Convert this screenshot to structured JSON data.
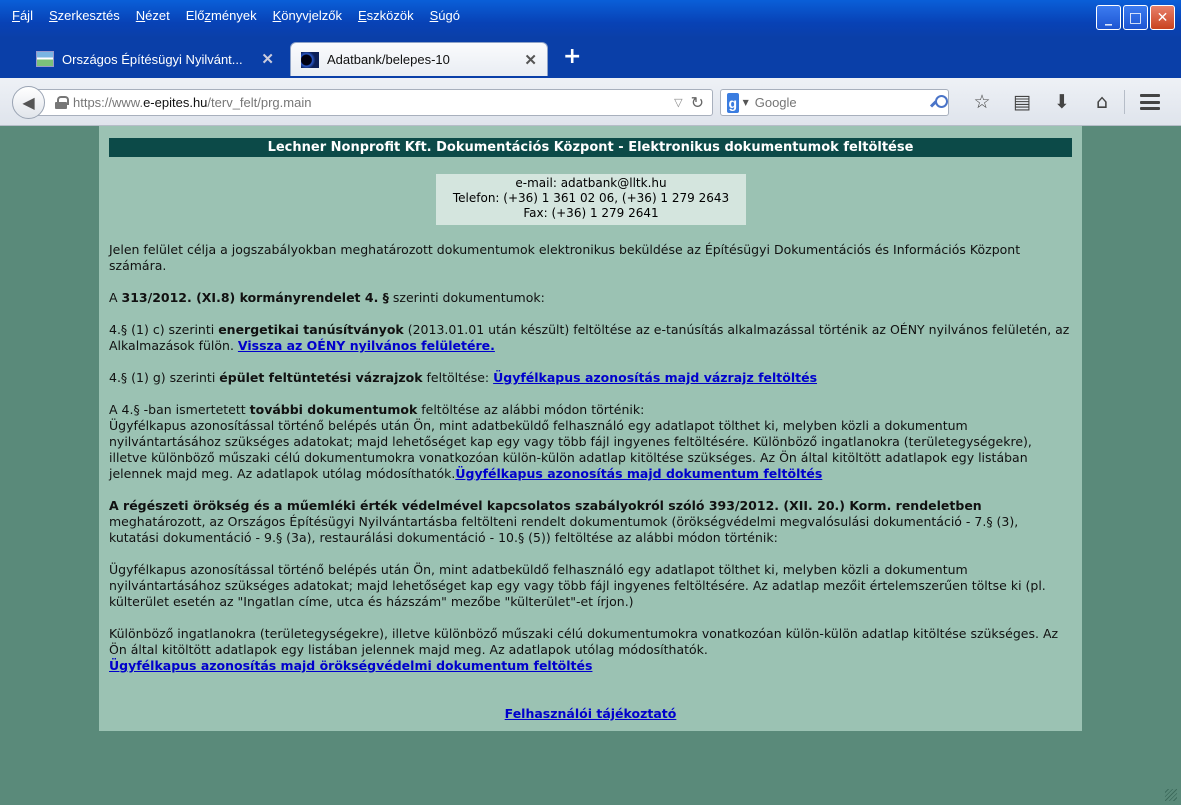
{
  "window": {
    "menu": [
      {
        "pre": "",
        "accel": "F",
        "post": "ájl"
      },
      {
        "pre": "",
        "accel": "S",
        "post": "zerkesztés"
      },
      {
        "pre": "",
        "accel": "N",
        "post": "ézet"
      },
      {
        "pre": "Elő",
        "accel": "z",
        "post": "mények"
      },
      {
        "pre": "",
        "accel": "K",
        "post": "önyvjelzők"
      },
      {
        "pre": "",
        "accel": "E",
        "post": "szközök"
      },
      {
        "pre": "",
        "accel": "S",
        "post": "úgó"
      }
    ]
  },
  "tabs": [
    {
      "label": "Országos Építésügyi Nyilvánt...",
      "close": "✕"
    },
    {
      "label": "Adatbank/belepes-10",
      "close": "✕"
    }
  ],
  "newtab": "+",
  "navbar": {
    "url_prefix": "https://www.",
    "url_domain": "e-epites.hu",
    "url_path": "/terv_felt/prg.main",
    "search_placeholder": "Google",
    "google_letter": "g"
  },
  "page": {
    "header": "Lechner Nonprofit Kft. Dokumentációs Központ - Elektronikus dokumentumok feltöltése",
    "contact": {
      "email": "e-mail: adatbank@lltk.hu",
      "phone": "Telefon: (+36) 1 361 02 06, (+36) 1 279 2643",
      "fax": "Fax: (+36) 1 279 2641"
    },
    "intro": "Jelen felület célja a jogszabályokban meghatározott dokumentumok elektronikus beküldése az Építésügyi Dokumentációs és Információs Központ számára.",
    "decree_pre": "A ",
    "decree_bold": "313/2012. (XI.8) kormányrendelet 4. §",
    "decree_post": " szerinti dokumentumok:",
    "energy_pre": "4.§ (1) c) szerinti ",
    "energy_bold": "energetikai tanúsítványok",
    "energy_post": " (2013.01.01 után készült) feltöltése az e-tanúsítás alkalmazással történik az OÉNY nyilvános felületén, az Alkalmazások fülön. ",
    "energy_link": "Vissza az OÉNY nyilvános felületére.",
    "sketch_pre": "4.§ (1) g) szerinti ",
    "sketch_bold": "épület feltüntetési vázrajzok",
    "sketch_post": " feltöltése: ",
    "sketch_link": "Ügyfélkapus azonosítás majd vázrajz feltöltés",
    "more_pre": "A 4.§ -ban ismertetett ",
    "more_bold": "további dokumentumok",
    "more_post": " feltöltése az alábbi módon történik:",
    "more_body": "Ügyfélkapus azonosítással történő belépés után Ön, mint adatbeküldő felhasználó egy adatlapot tölthet ki, melyben közli a dokumentum nyilvántartásához szükséges adatokat; majd lehetőséget kap egy vagy több fájl ingyenes feltöltésére. Különböző ingatlanokra (területegységekre), illetve különböző műszaki célú dokumentumokra vonatkozóan külön-külön adatlap kitöltése szükséges. Az Ön által kitöltött adatlapok egy listában jelennek majd meg. Az adatlapok utólag módosíthatók.",
    "more_link": "Ügyfélkapus azonosítás majd dokumentum feltöltés",
    "heritage_bold": "A régészeti örökség és a műemléki érték védelmével kapcsolatos szabályokról szóló 393/2012. (XII. 20.) Korm. rendeletben",
    "heritage_post": " meghatározott, az Országos Építésügyi Nyilvántartásba feltölteni rendelt dokumentumok (örökségvédelmi megvalósulási dokumentáció - 7.§ (3), kutatási dokumentáció - 9.§ (3a), restaurálási dokumentáció - 10.§ (5)) feltöltése az alábbi módon történik:",
    "heritage_p2": "Ügyfélkapus azonosítással történő belépés után Ön, mint adatbeküldő felhasználó egy adatlapot tölthet ki, melyben közli a dokumentum nyilvántartásához szükséges adatokat; majd lehetőséget kap egy vagy több fájl ingyenes feltöltésére. Az adatlap mezőit értelemszerűen töltse ki (pl. külterület esetén az \"Ingatlan címe, utca és házszám\" mezőbe \"külterület\"-et írjon.)",
    "heritage_p3": "Különböző ingatlanokra (területegységekre), illetve különböző műszaki célú dokumentumokra vonatkozóan külön-külön adatlap kitöltése szükséges. Az Ön által kitöltött adatlapok egy listában jelennek majd meg. Az adatlapok utólag módosíthatók.",
    "heritage_link": "Ügyfélkapus azonosítás majd örökségvédelmi dokumentum feltöltés",
    "footer_link": "Felhasználói tájékoztató"
  }
}
